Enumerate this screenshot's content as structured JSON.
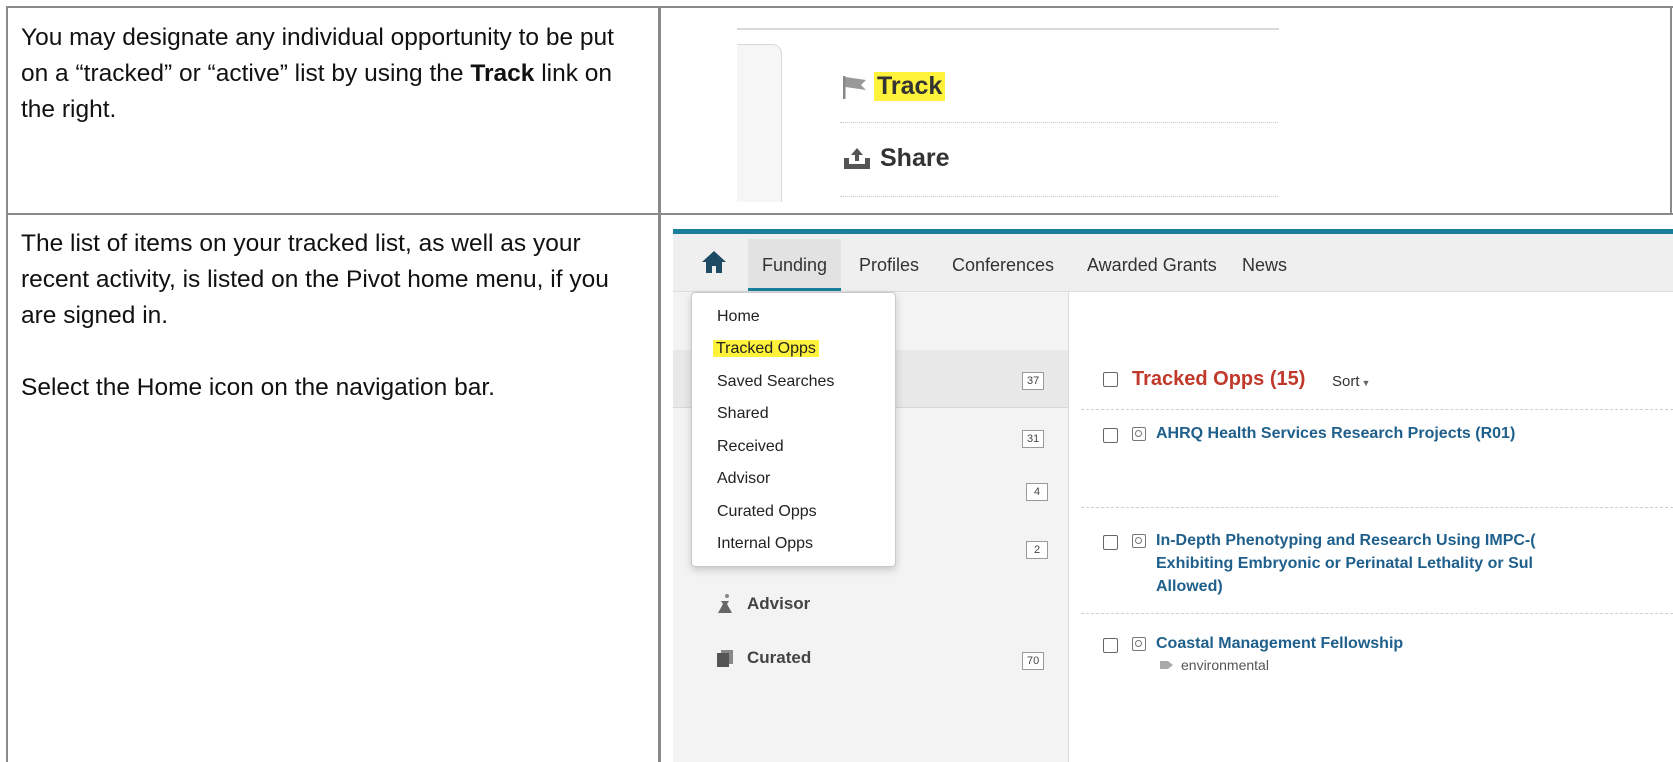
{
  "row1": {
    "text_before": "You may designate any individual opportunity to be put on a “tracked” or “active” list by using the ",
    "text_bold": "Track",
    "text_after": " link on the right.",
    "track_label": "Track",
    "share_label": "Share"
  },
  "row2": {
    "paragraph1": "The list of items on your tracked list, as well as your recent activity, is listed on the Pivot home menu, if you are signed in.",
    "paragraph2": "Select the Home icon on the navigation bar."
  },
  "pivot": {
    "colors": {
      "accent": "#1a7f9b",
      "highlight": "#fff23a",
      "tracked_title": "#c0392b",
      "link": "#1f5f8b"
    },
    "nav": {
      "items": [
        "Funding",
        "Profiles",
        "Conferences",
        "Awarded Grants",
        "News"
      ],
      "active": "Funding"
    },
    "menu": {
      "items": [
        "Home",
        "Tracked Opps",
        "Saved Searches",
        "Shared",
        "Received",
        "Advisor",
        "Curated Opps",
        "Internal Opps"
      ],
      "highlighted": "Tracked Opps"
    },
    "sidebar": {
      "counts": [
        "37",
        "31",
        "4",
        "2",
        "70"
      ],
      "advisor_label": "Advisor",
      "curated_label": "Curated"
    },
    "main": {
      "title": "Tracked Opps (15)",
      "sort_label": "Sort",
      "opportunities": [
        "AHRQ Health Services Research Projects (R01)",
        "In-Depth Phenotyping and Research Using IMPC-(",
        "Exhibiting Embryonic or Perinatal Lethality or Sul",
        "Allowed)",
        "Coastal Management Fellowship"
      ],
      "tag": "environmental"
    }
  }
}
